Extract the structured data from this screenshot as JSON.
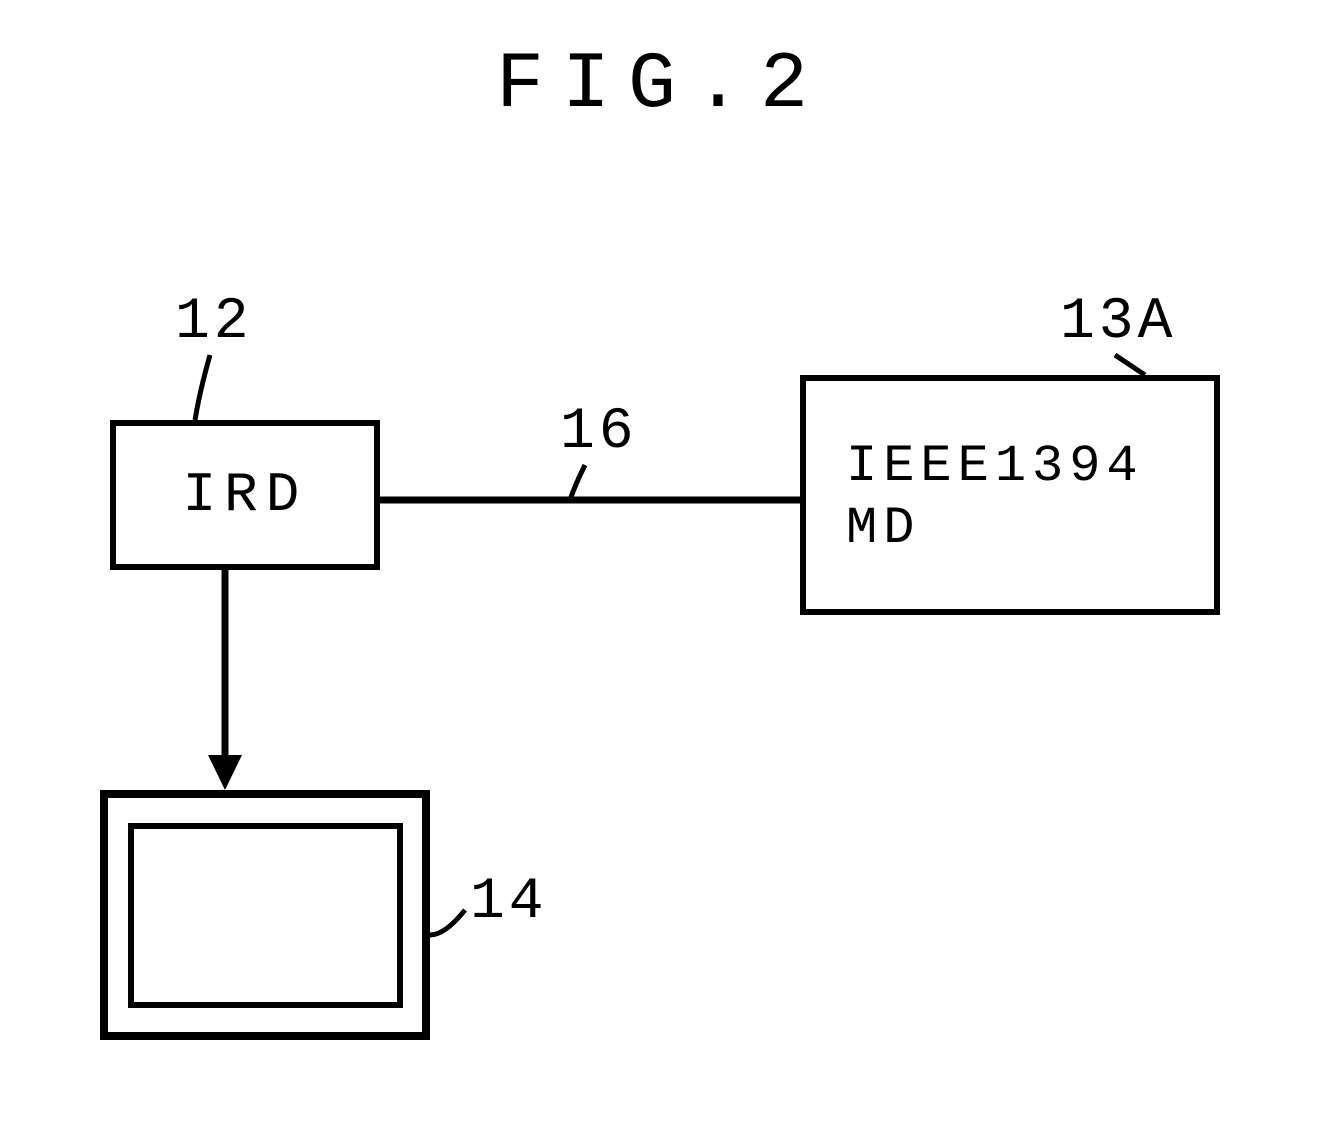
{
  "title": "FIG.2",
  "blocks": {
    "ird": {
      "label": "IRD",
      "ref": "12"
    },
    "ieee": {
      "line1": "IEEE1394",
      "line2": "MD",
      "ref": "13A"
    },
    "monitor": {
      "ref": "14"
    }
  },
  "connections": {
    "bus": {
      "ref": "16"
    }
  }
}
